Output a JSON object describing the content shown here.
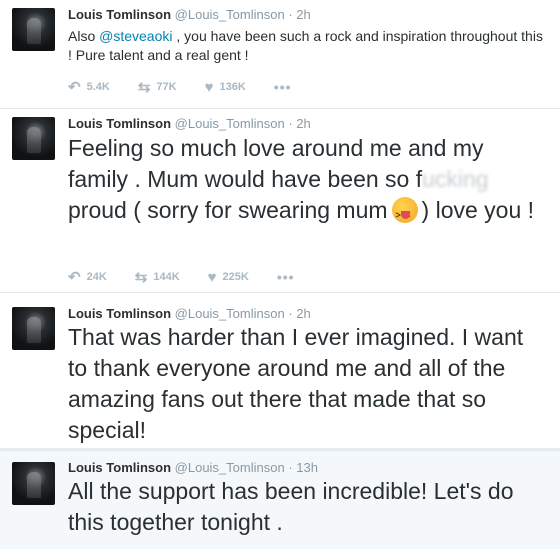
{
  "tweets": [
    {
      "name": "Louis Tomlinson",
      "handle": "@Louis_Tomlinson",
      "dot": "·",
      "time": "2h",
      "text_pre": "Also ",
      "mention": "@steveaoki",
      "text_post": " , you have been such a rock and inspiration throughout this ! Pure talent and a real gent !",
      "replies": "5.4K",
      "retweets": "77K",
      "likes": "136K",
      "more": "•••"
    },
    {
      "name": "Louis Tomlinson",
      "handle": "@Louis_Tomlinson",
      "dot": "·",
      "time": "2h",
      "text_a": "Feeling so much love around me and my family . Mum would have been so f",
      "text_blur": "ucking",
      "text_b": " proud ( sorry for swearing mum",
      "text_c": ") love you !",
      "emoji": "squinting-tongue-emoji",
      "replies": "24K",
      "retweets": "144K",
      "likes": "225K",
      "more": "•••"
    },
    {
      "name": "Louis Tomlinson",
      "handle": "@Louis_Tomlinson",
      "dot": "·",
      "time": "2h",
      "text": "That was harder than I ever imagined. I want to thank everyone around me and all of the amazing fans out there that made that so special!"
    },
    {
      "name": "Louis Tomlinson",
      "handle": "@Louis_Tomlinson",
      "dot": "·",
      "time": "13h",
      "text": "All the support has been incredible! Let's do this together tonight ."
    }
  ],
  "icons": {
    "reply": "reply-icon",
    "retweet": "retweet-icon",
    "like": "heart-icon",
    "more": "more-icon"
  },
  "colors": {
    "link": "#0084b4",
    "muted": "#8899a6",
    "action": "#aab8c2",
    "highlight_bg": "#f5f8fa"
  }
}
